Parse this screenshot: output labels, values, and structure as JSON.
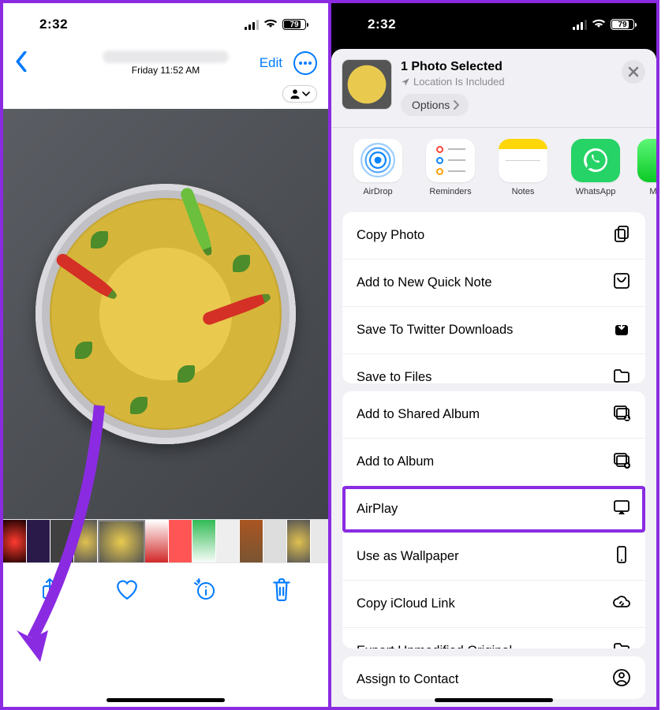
{
  "status": {
    "time": "2:32",
    "battery_pct": "79",
    "battery_fill_pct": 79
  },
  "left": {
    "timestamp": "Friday  11:52 AM",
    "edit_label": "Edit",
    "toolbar": {
      "share": "Share",
      "favorite": "Favorite",
      "info": "Info",
      "delete": "Delete"
    }
  },
  "sheet": {
    "title": "1 Photo Selected",
    "subtitle": "Location Is Included",
    "options_label": "Options",
    "apps": [
      {
        "id": "airdrop",
        "label": "AirDrop"
      },
      {
        "id": "reminders",
        "label": "Reminders"
      },
      {
        "id": "notes",
        "label": "Notes"
      },
      {
        "id": "whatsapp",
        "label": "WhatsApp"
      },
      {
        "id": "messages",
        "label": "M"
      }
    ],
    "actions_group1": [
      {
        "id": "copy-photo",
        "label": "Copy Photo",
        "icon": "copy"
      },
      {
        "id": "quick-note",
        "label": "Add to New Quick Note",
        "icon": "quicknote"
      },
      {
        "id": "twitter-dl",
        "label": "Save To Twitter Downloads",
        "icon": "download"
      },
      {
        "id": "save-files",
        "label": "Save to Files",
        "icon": "folder"
      }
    ],
    "actions_group2": [
      {
        "id": "shared-album",
        "label": "Add to Shared Album",
        "icon": "album-shared"
      },
      {
        "id": "add-album",
        "label": "Add to Album",
        "icon": "album-add"
      },
      {
        "id": "airplay",
        "label": "AirPlay",
        "icon": "airplay",
        "highlighted": true
      },
      {
        "id": "wallpaper",
        "label": "Use as Wallpaper",
        "icon": "phone"
      },
      {
        "id": "icloud-link",
        "label": "Copy iCloud Link",
        "icon": "cloud-link"
      },
      {
        "id": "export-orig",
        "label": "Export Unmodified Original",
        "icon": "folder"
      }
    ],
    "actions_group3": [
      {
        "id": "assign-contact",
        "label": "Assign to Contact",
        "icon": "contact"
      }
    ]
  }
}
